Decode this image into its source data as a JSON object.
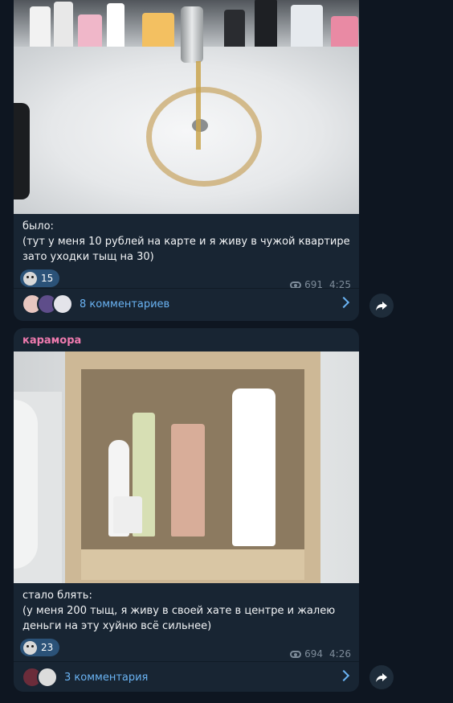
{
  "messages": [
    {
      "caption": "было:\n(тут у меня 10 рублей на карте и я живу в чужой квартире зато уходки тыщ на 30)",
      "reaction_count": "15",
      "views": "691",
      "time": "4:25",
      "comments_label": "8 комментариев",
      "photo_desc_icon": "sink-photo"
    },
    {
      "author": "карамора",
      "caption": "стало блять:\n(у меня 200 тыщ, я живу в своей хате в центре и жалею деньги на эту хуйню всё сильнее)",
      "reaction_count": "23",
      "views": "694",
      "time": "4:26",
      "comments_label": "3 комментария",
      "photo_desc_icon": "shelf-photo"
    }
  ],
  "colors": {
    "background": "#0e1621",
    "bubble": "#182533",
    "accent": "#6ab3f3",
    "author": "#ee7aae"
  }
}
